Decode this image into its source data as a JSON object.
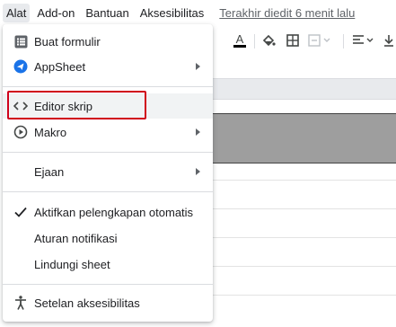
{
  "menubar": {
    "items": [
      "Alat",
      "Add-on",
      "Bantuan",
      "Aksesibilitas"
    ],
    "last_edit": "Terakhir diedit 6 menit lalu"
  },
  "toolbar": {
    "icons": [
      "text-color-icon",
      "fill-color-icon",
      "borders-icon",
      "merge-cells-icon",
      "horizontal-align-icon",
      "vertical-align-icon"
    ]
  },
  "dropdown": {
    "items": [
      {
        "label": "Buat formulir",
        "icon": "form-icon",
        "submenu": false
      },
      {
        "label": "AppSheet",
        "icon": "appsheet-icon",
        "submenu": true
      },
      {
        "label": "Editor skrip",
        "icon": "code-icon",
        "submenu": false,
        "highlighted": true
      },
      {
        "label": "Makro",
        "icon": "macro-play-icon",
        "submenu": true
      },
      {
        "label": "Ejaan",
        "icon": "",
        "submenu": true
      },
      {
        "label": "Aktifkan pelengkapan otomatis",
        "icon": "checkmark-icon",
        "submenu": false,
        "checked": true
      },
      {
        "label": "Aturan notifikasi",
        "icon": "",
        "submenu": false
      },
      {
        "label": "Lindungi sheet",
        "icon": "",
        "submenu": false
      },
      {
        "label": "Setelan aksesibilitas",
        "icon": "accessibility-icon",
        "submenu": false
      }
    ]
  },
  "colors": {
    "highlight_border": "#d0021b",
    "appsheet_blue": "#1a73e8",
    "text": "#202124"
  }
}
